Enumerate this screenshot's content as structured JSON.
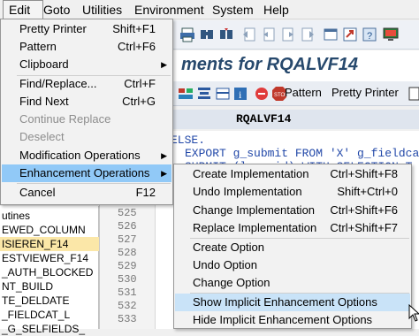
{
  "menubar": {
    "items": [
      "Edit",
      "Goto",
      "Utilities",
      "Environment",
      "System",
      "Help"
    ]
  },
  "screen": {
    "title": "ments for RQALVF14",
    "toolbar_buttons": [
      "Pattern",
      "Pretty Printer"
    ],
    "program_name": "RQALVF14"
  },
  "edit_menu": {
    "items": [
      {
        "label": "Pretty Printer",
        "shortcut": "Shift+F1",
        "state": "enabled"
      },
      {
        "label": "Pattern",
        "shortcut": "Ctrl+F6",
        "state": "enabled"
      },
      {
        "label": "Clipboard",
        "shortcut": "",
        "state": "enabled",
        "submenu": true
      },
      {
        "label": "Find/Replace...",
        "shortcut": "Ctrl+F",
        "state": "enabled"
      },
      {
        "label": "Find Next",
        "shortcut": "Ctrl+G",
        "state": "enabled"
      },
      {
        "label": "Continue Replace",
        "shortcut": "",
        "state": "disabled"
      },
      {
        "label": "Deselect",
        "shortcut": "",
        "state": "disabled"
      },
      {
        "label": "Modification Operations",
        "shortcut": "",
        "state": "enabled",
        "submenu": true
      },
      {
        "label": "Enhancement Operations",
        "shortcut": "",
        "state": "highlighted",
        "submenu": true
      },
      {
        "label": "Cancel",
        "shortcut": "F12",
        "state": "enabled"
      }
    ]
  },
  "enhancement_submenu": {
    "items": [
      {
        "label": "Create Implementation",
        "shortcut": "Ctrl+Shift+F8"
      },
      {
        "label": "Undo Implementation",
        "shortcut": "Shift+Ctrl+0"
      },
      {
        "label": "Change Implementation",
        "shortcut": "Ctrl+Shift+F6"
      },
      {
        "label": "Replace Implementation",
        "shortcut": "Ctrl+Shift+F7"
      },
      {
        "label": "Create Option",
        "shortcut": ""
      },
      {
        "label": "Undo Option",
        "shortcut": ""
      },
      {
        "label": "Change Option",
        "shortcut": ""
      },
      {
        "label": "Show Implicit Enhancement Options",
        "shortcut": "",
        "state": "highlighted"
      },
      {
        "label": "Hide Implicit Enhancement Options",
        "shortcut": ""
      }
    ]
  },
  "editor": {
    "line_numbers": [
      "525",
      "526",
      "527",
      "528",
      "529",
      "530",
      "531",
      "532",
      "533"
    ],
    "code_lines": [
      "ELSE.",
      "EXPORT g_submit FROM 'X' g_fieldcat_",
      "SUBMIT (l_repid) WITH SELECTION-T"
    ]
  },
  "tree": {
    "header": "utines",
    "rows": [
      {
        "label": "EWED_COLUMN",
        "selected": false
      },
      {
        "label": "ISIEREN_F14",
        "selected": true
      },
      {
        "label": "ESTVIEWER_F14",
        "selected": false
      },
      {
        "label": "_AUTH_BLOCKED",
        "selected": false
      },
      {
        "label": "NT_BUILD",
        "selected": false
      },
      {
        "label": "TE_DELDATE",
        "selected": false
      },
      {
        "label": "_FIELDCAT_L",
        "selected": false
      },
      {
        "label": "_G_SELFIELDS_",
        "selected": false
      }
    ]
  },
  "colors": {
    "menu_highlight": "#91c9f7",
    "submenu_highlight": "#c9e3f8",
    "tree_selection": "#fbe7a8",
    "title_text": "#27496d",
    "code_text": "#2248a8"
  }
}
